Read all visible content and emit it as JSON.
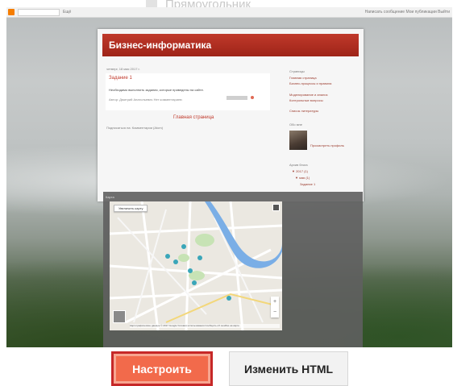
{
  "ghost_label": "Прямоугольник",
  "preview": {
    "topbar": {
      "more_label": "Ещё",
      "right_label": "Написать сообщение   Мои публикации   Выйти"
    },
    "blog": {
      "title": "Бизнес-информатика",
      "post_date": "четверг, 18 мая 2017 г.",
      "post_title": "Задание 1",
      "post_text": "Необходимо выполнить задания, которые приведены на сайте.",
      "post_meta": "Автор: Дмитрий Анатольевич   Нет комментариев:",
      "home_link": "Главная страница",
      "subscribe": "Подписаться на: Комментарии (Atom)",
      "sidebar": {
        "pages_heading": "Страницы",
        "pages": [
          "Главная страница",
          "Бизнес-процессы и правила",
          "Моделирование и анализ",
          "Контрольные вопросы",
          "Список литературы"
        ],
        "about_heading": "Обо мне",
        "profile_link": "Просмотреть профиль",
        "archive_heading": "Архив блога",
        "archive": [
          "▼ 2017 (1)",
          "▼ мая (1)",
          "Задание 1"
        ]
      },
      "map": {
        "section_label": "Карта",
        "view_larger": "Увеличить карту",
        "zoom_in": "+",
        "zoom_out": "−",
        "attribution": "Картографические данные © 2017 Google   Условия использования   Сообщить об ошибке на карте"
      }
    }
  },
  "buttons": {
    "customize": "Настроить",
    "edit_html": "Изменить HTML"
  },
  "colors": {
    "accent": "#f26a4b",
    "highlight_border": "#c62828",
    "header": "#b03427"
  }
}
